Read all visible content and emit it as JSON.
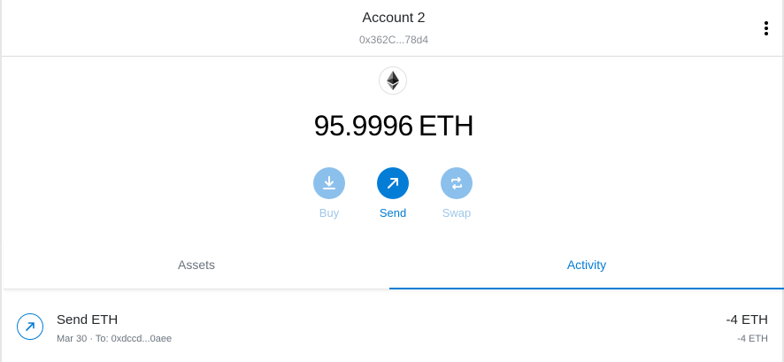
{
  "header": {
    "account_name": "Account 2",
    "account_address": "0x362C...78d4",
    "menu_icon": "kebab-menu-icon"
  },
  "balance": {
    "token_icon": "ethereum-icon",
    "amount": "95.9996",
    "unit": "ETH"
  },
  "actions": [
    {
      "label": "Buy",
      "icon": "download-icon",
      "enabled": false
    },
    {
      "label": "Send",
      "icon": "arrow-up-right-icon",
      "enabled": true
    },
    {
      "label": "Swap",
      "icon": "swap-arrows-icon",
      "enabled": false
    }
  ],
  "tabs": [
    {
      "label": "Assets",
      "active": false
    },
    {
      "label": "Activity",
      "active": true
    }
  ],
  "activity": [
    {
      "title": "Send ETH",
      "date": "Mar 30",
      "separator": "·",
      "recipient": "To: 0xdccd...0aee",
      "amount": "-4 ETH",
      "fiat_amount": "-4 ETH",
      "icon": "arrow-up-right-icon"
    }
  ],
  "colors": {
    "primary": "#037dd6",
    "disabled": "#8cc0ec",
    "text": "#24272a",
    "muted": "#6a737d"
  }
}
